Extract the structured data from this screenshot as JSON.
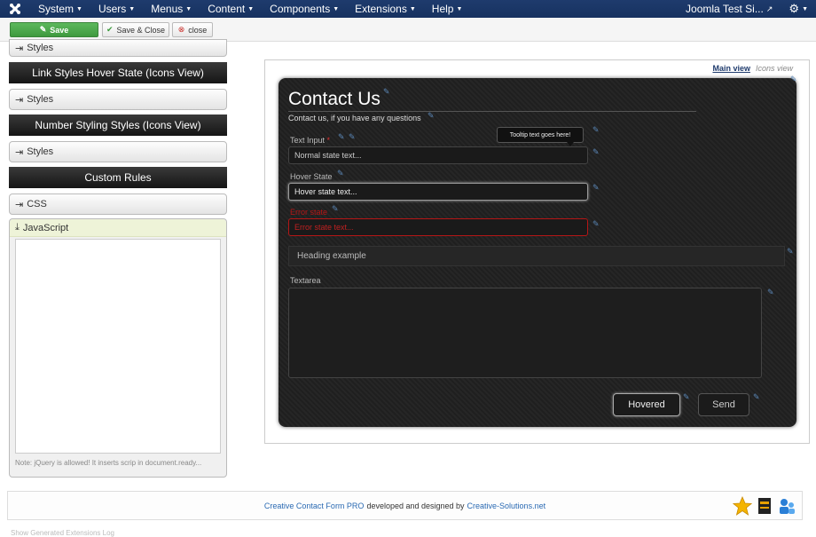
{
  "navbar": {
    "menus": [
      "System",
      "Users",
      "Menus",
      "Content",
      "Components",
      "Extensions",
      "Help"
    ],
    "site_name": "Joomla Test Si..."
  },
  "toolbar": {
    "save_label": "Save",
    "save_close_label": "Save & Close",
    "close_label": "close"
  },
  "sidebar": {
    "styles_label": "Styles",
    "link_hover_heading": "Link Styles Hover State (Icons View)",
    "number_styling_heading": "Number Styling Styles (Icons View)",
    "custom_rules_heading": "Custom Rules",
    "css_label": "CSS",
    "javascript_label": "JavaScript",
    "js_note": "Note: jQuery is allowed! It inserts scrip in document.ready..."
  },
  "preview": {
    "main_view_label": "Main view",
    "icons_view_label": "Icons view",
    "form_title": "Contact Us",
    "form_subtitle": "Contact us, if you have any questions",
    "text_input_label": "Text Input",
    "required_mark": "*",
    "tooltip_text": "Tooltip text goes here!",
    "normal_value": "Normal state text...",
    "hover_label": "Hover State",
    "hover_value": "Hover state text...",
    "error_label": "Error state",
    "error_value": "Error state text...",
    "heading_example": "Heading example",
    "textarea_label": "Textarea",
    "hovered_button": "Hovered",
    "send_button": "Send"
  },
  "footer": {
    "product_link": "Creative Contact Form PRO",
    "middle_text": "developed and designed by",
    "company_link": "Creative-Solutions.net"
  },
  "below_footer_text": "Show Generated Extensions Log",
  "colors": {
    "navbar_bg": "#1e3b6d",
    "save_green": "#4cae4c",
    "error_red": "#b51616",
    "link_blue": "#2a6ab3"
  }
}
